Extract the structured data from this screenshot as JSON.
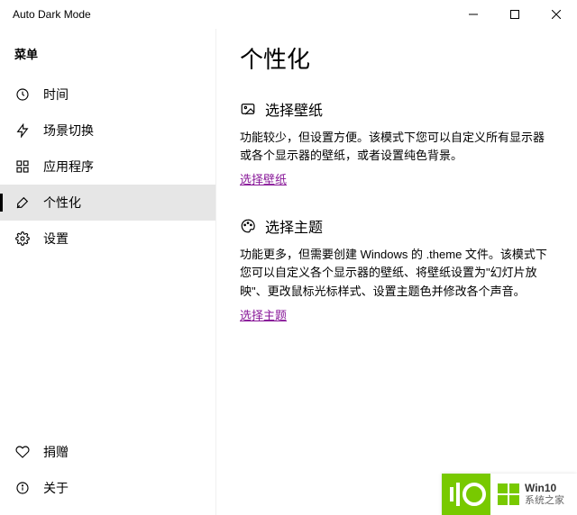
{
  "titlebar": {
    "title": "Auto Dark Mode"
  },
  "sidebar": {
    "header": "菜单",
    "items": [
      {
        "label": "时间"
      },
      {
        "label": "场景切换"
      },
      {
        "label": "应用程序"
      },
      {
        "label": "个性化"
      },
      {
        "label": "设置"
      }
    ],
    "bottom": [
      {
        "label": "捐赠"
      },
      {
        "label": "关于"
      }
    ]
  },
  "content": {
    "page_title": "个性化",
    "sections": [
      {
        "title": "选择壁纸",
        "desc": "功能较少，但设置方便。该模式下您可以自定义所有显示器或各个显示器的壁纸，或者设置纯色背景。",
        "link": "选择壁纸"
      },
      {
        "title": "选择主题",
        "desc": "功能更多，但需要创建 Windows 的 .theme 文件。该模式下您可以自定义各个显示器的壁纸、将壁纸设置为\"幻灯片放映\"、更改鼠标光标样式、设置主题色并修改各个声音。",
        "link": "选择主题"
      }
    ]
  },
  "watermark": {
    "t1": "Win10",
    "t2": "系统之家"
  }
}
